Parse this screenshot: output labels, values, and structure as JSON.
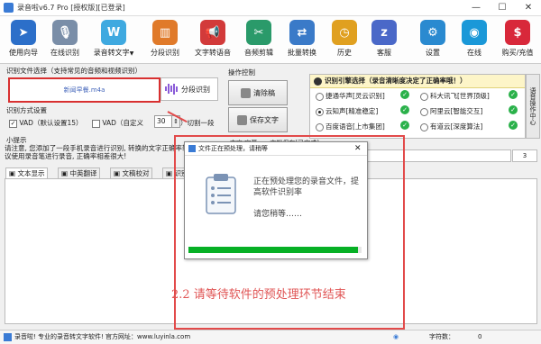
{
  "window": {
    "title": "录音啦v6.7 Pro [授权版][已登录]",
    "minimize": "—",
    "maximize": "☐",
    "close": "✕"
  },
  "toolbar": {
    "items": [
      {
        "label": "使用向导",
        "icon": "rocket-icon",
        "color": "#2c6fc9"
      },
      {
        "label": "在线识别",
        "icon": "microphone-icon",
        "color": "#7a8ea8"
      },
      {
        "label": "录音转文字",
        "icon": "w-logo-icon",
        "color": "#3fa9e0",
        "dropdown": "▼"
      },
      {
        "label": "分段识别",
        "icon": "segments-icon",
        "color": "#e07a2a"
      },
      {
        "label": "文字转语音",
        "icon": "megaphone-icon",
        "color": "#d23a3a"
      },
      {
        "label": "音频剪辑",
        "icon": "scissors-icon",
        "color": "#2a9a6a"
      },
      {
        "label": "批量转换",
        "icon": "batch-icon",
        "color": "#3a7ac8"
      },
      {
        "label": "历史",
        "icon": "history-icon",
        "color": "#e0a020"
      },
      {
        "label": "客服",
        "icon": "support-icon",
        "color": "#4a68c8"
      },
      {
        "label": "设置",
        "icon": "gear-icon",
        "color": "#2a8ad0"
      },
      {
        "label": "在线",
        "icon": "online-icon",
        "color": "#1a98d8"
      },
      {
        "label": "购买/充值",
        "icon": "cart-icon",
        "color": "#d8283a"
      }
    ]
  },
  "file_select": {
    "title": "识别文件选择（支持常见的音频和视频识别）",
    "file_name": "新闻早餐.m4a",
    "segment_button": "分段识别"
  },
  "recognition_mode": {
    "title": "识别方式设置",
    "vad_default": "VAD（默认设置15）",
    "vad_custom": "VAD（自定义",
    "custom_value": "30",
    "spin": "⇕",
    "suffix": "）切割一段"
  },
  "operation": {
    "title": "操作控制",
    "clear_button": "清除稿",
    "save_button": "保存文字"
  },
  "engine": {
    "title": "识别引擎选择（录音清晰度决定了正确率哦！）",
    "engines": [
      {
        "name": "捷通华声[灵云识别]",
        "selected": false
      },
      {
        "name": "科大讯飞[世界顶级]",
        "selected": false
      },
      {
        "name": "云知声[精准稳定]",
        "selected": true
      },
      {
        "name": "阿里云[智能交互]",
        "selected": false
      },
      {
        "name": "百度语音[上市集团]",
        "selected": false
      },
      {
        "name": "有道云[深度算法]",
        "selected": false
      }
    ],
    "side_tab": "语音操作中心"
  },
  "tips": {
    "title": "小提示",
    "text": "请注意, 您添加了一段手机录音进行识别, 转换的文字正确率较低, 强烈建议使用录音笔进行录音, 正确率相差很大!",
    "status_label": "文字/字幕……文档保存[已完成]",
    "status_value": "3"
  },
  "tabs": [
    "文本显示",
    "中英翻译",
    "文稿校对",
    "识别引擎"
  ],
  "dialog": {
    "title": "文件正在预处理，请稍等",
    "message": "正在预处理您的录音文件，提高软件识别率",
    "wait": "请您稍等……",
    "progress": 0.98
  },
  "caption": "2.2 请等待软件的预处理环节结束",
  "footer": {
    "left": "录音啦! 专业的录音转文字软件! 官方网址：www.luyinla.com",
    "right_label": "字符数：",
    "right_value": "0"
  },
  "colors": {
    "accent_red": "#e24a4a",
    "progress_green": "#06b025",
    "engine_header": "#fdf5c8"
  }
}
